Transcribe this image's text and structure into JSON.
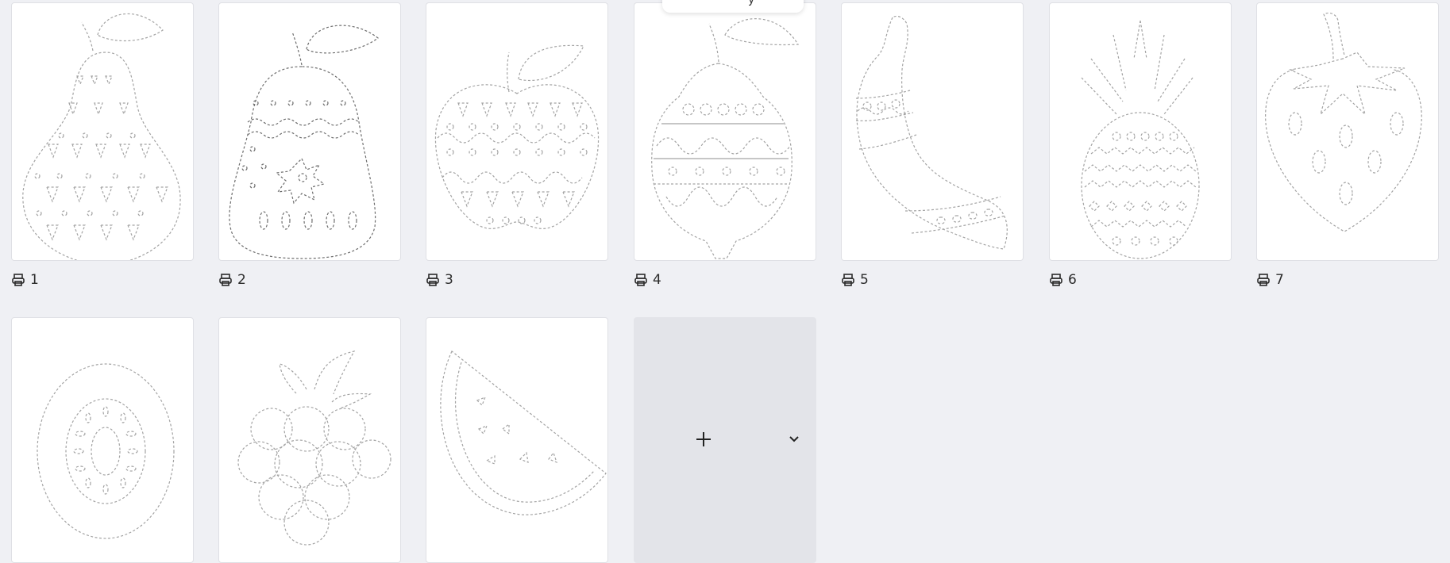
{
  "pages": [
    {
      "number": "1",
      "fruit": "pear-icon"
    },
    {
      "number": "2",
      "fruit": "pear-icon"
    },
    {
      "number": "3",
      "fruit": "apple-icon"
    },
    {
      "number": "4",
      "fruit": "lemon-icon"
    },
    {
      "number": "5",
      "fruit": "banana-icon"
    },
    {
      "number": "6",
      "fruit": "pineapple-icon"
    },
    {
      "number": "7",
      "fruit": "strawberry-icon"
    },
    {
      "number": "",
      "fruit": "kiwi-icon"
    },
    {
      "number": "",
      "fruit": "raspberry-icon"
    },
    {
      "number": "",
      "fruit": "watermelon-icon"
    }
  ],
  "add_page": {
    "plus_icon": "plus-icon",
    "dropdown_icon": "chevron-down-icon"
  },
  "tooltip": {
    "text": "y"
  },
  "colors": {
    "background": "#eff0f4",
    "card": "#ffffff",
    "add_card": "#e3e4e9",
    "outline": "#a3a3a3"
  }
}
